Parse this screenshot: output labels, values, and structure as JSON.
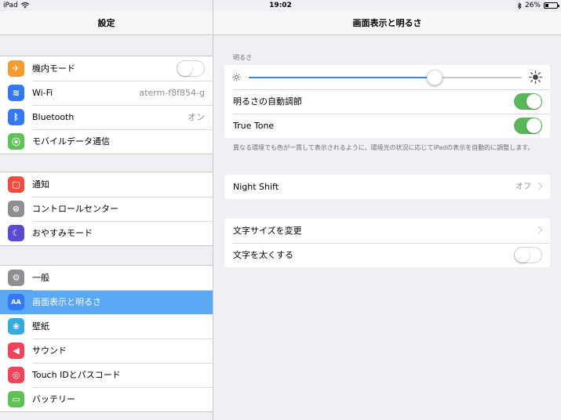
{
  "status": {
    "device": "iPad",
    "time": "19:02",
    "battery": "26%",
    "battery_level": 0.26
  },
  "left": {
    "title": "設定",
    "groups": [
      [
        {
          "label": "機内モード",
          "icon": "airplane-icon",
          "color": "#f59b2f",
          "toggle": "off"
        },
        {
          "label": "Wi-Fi",
          "icon": "wifi-icon",
          "color": "#3478f6",
          "value": "aterm-f8f854-g"
        },
        {
          "label": "Bluetooth",
          "icon": "bluetooth-icon",
          "color": "#3478f6",
          "value": "オン"
        },
        {
          "label": "モバイルデータ通信",
          "icon": "cellular-icon",
          "color": "#5ec354"
        }
      ],
      [
        {
          "label": "通知",
          "icon": "notifications-icon",
          "color": "#f24d3f"
        },
        {
          "label": "コントロールセンター",
          "icon": "control-center-icon",
          "color": "#8e8e93"
        },
        {
          "label": "おやすみモード",
          "icon": "moon-icon",
          "color": "#5b4bcf"
        }
      ],
      [
        {
          "label": "一般",
          "icon": "gear-icon",
          "color": "#8e8e93"
        },
        {
          "label": "画面表示と明るさ",
          "icon": "display-icon",
          "color": "#3478f6",
          "selected": true
        },
        {
          "label": "壁紙",
          "icon": "wallpaper-icon",
          "color": "#36aadc"
        },
        {
          "label": "サウンド",
          "icon": "sound-icon",
          "color": "#f0445a"
        },
        {
          "label": "Touch IDとパスコード",
          "icon": "fingerprint-icon",
          "color": "#f0445a"
        },
        {
          "label": "バッテリー",
          "icon": "battery-icon",
          "color": "#5ec354"
        }
      ]
    ]
  },
  "right": {
    "title": "画面表示と明るさ",
    "brightness_header": "明るさ",
    "brightness_level": 0.68,
    "auto_brightness_label": "明るさの自動調節",
    "auto_brightness": "on",
    "true_tone_label": "True Tone",
    "true_tone": "on",
    "footnote": "異なる環境でも色が一貫して表示されるように、環境光の状況に応じてiPadの表示を自動的に調整します。",
    "night_shift_label": "Night Shift",
    "night_shift_value": "オフ",
    "text_size_label": "文字サイズを変更",
    "bold_text_label": "文字を太くする",
    "bold_text": "off"
  }
}
